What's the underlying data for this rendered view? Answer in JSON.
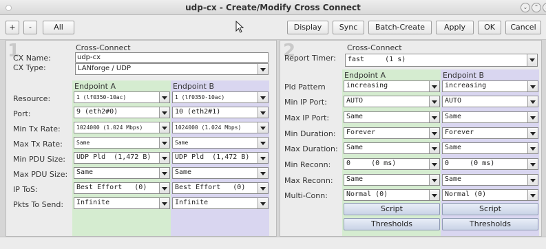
{
  "window": {
    "title": "udp-cx - Create/Modify Cross Connect"
  },
  "toolbar": {
    "plus": "+",
    "minus": "-",
    "all": "All",
    "display": "Display",
    "sync": "Sync",
    "batch_create": "Batch-Create",
    "apply": "Apply",
    "ok": "OK",
    "cancel": "Cancel"
  },
  "left": {
    "watermark": "1",
    "section_title": "Cross-Connect",
    "cx_name_label": "CX Name:",
    "cx_name_value": "udp-cx",
    "cx_type_label": "CX Type:",
    "cx_type_value": "LANforge / UDP",
    "endpoint_a": "Endpoint A",
    "endpoint_b": "Endpoint B",
    "rows": [
      {
        "label": "Resource:",
        "a": "1 (lf0350-10ac)",
        "b": "1 (lf0350-10ac)"
      },
      {
        "label": "Port:",
        "a": "9 (eth2#0)",
        "b": "10 (eth2#1)"
      },
      {
        "label": "Min Tx Rate:",
        "a": "1024000 (1.024 Mbps)",
        "b": "1024000 (1.024 Mbps)"
      },
      {
        "label": "Max Tx Rate:",
        "a": "Same",
        "b": "Same"
      },
      {
        "label": "Min PDU Size:",
        "a": "UDP Pld  (1,472 B)",
        "b": "UDP Pld  (1,472 B)"
      },
      {
        "label": "Max PDU Size:",
        "a": "Same",
        "b": "Same"
      },
      {
        "label": "IP ToS:",
        "a": "Best Effort   (0)",
        "b": "Best Effort   (0)"
      },
      {
        "label": "Pkts To Send:",
        "a": "Infinite",
        "b": "Infinite"
      }
    ]
  },
  "right": {
    "watermark": "2",
    "section_title": "Cross-Connect",
    "report_timer_label": "Report Timer:",
    "report_timer_value": "fast     (1 s)",
    "endpoint_a": "Endpoint A",
    "endpoint_b": "Endpoint B",
    "rows": [
      {
        "label": "Pld Pattern",
        "a": "increasing",
        "b": "increasing"
      },
      {
        "label": "Min IP Port:",
        "a": "AUTO",
        "b": "AUTO"
      },
      {
        "label": "Max IP Port:",
        "a": "Same",
        "b": "Same"
      },
      {
        "label": "Min Duration:",
        "a": "Forever",
        "b": "Forever"
      },
      {
        "label": "Max Duration:",
        "a": "Same",
        "b": "Same"
      },
      {
        "label": "Min Reconn:",
        "a": "0     (0 ms)",
        "b": "0     (0 ms)"
      },
      {
        "label": "Max Reconn:",
        "a": "Same",
        "b": "Same"
      },
      {
        "label": "Multi-Conn:",
        "a": "Normal (0)",
        "b": "Normal (0)"
      }
    ],
    "script_label": "Script",
    "thresholds_label": "Thresholds"
  },
  "colors": {
    "endpoint_a_bg": "#d5ecd0",
    "endpoint_b_bg": "#d9d6f0"
  }
}
